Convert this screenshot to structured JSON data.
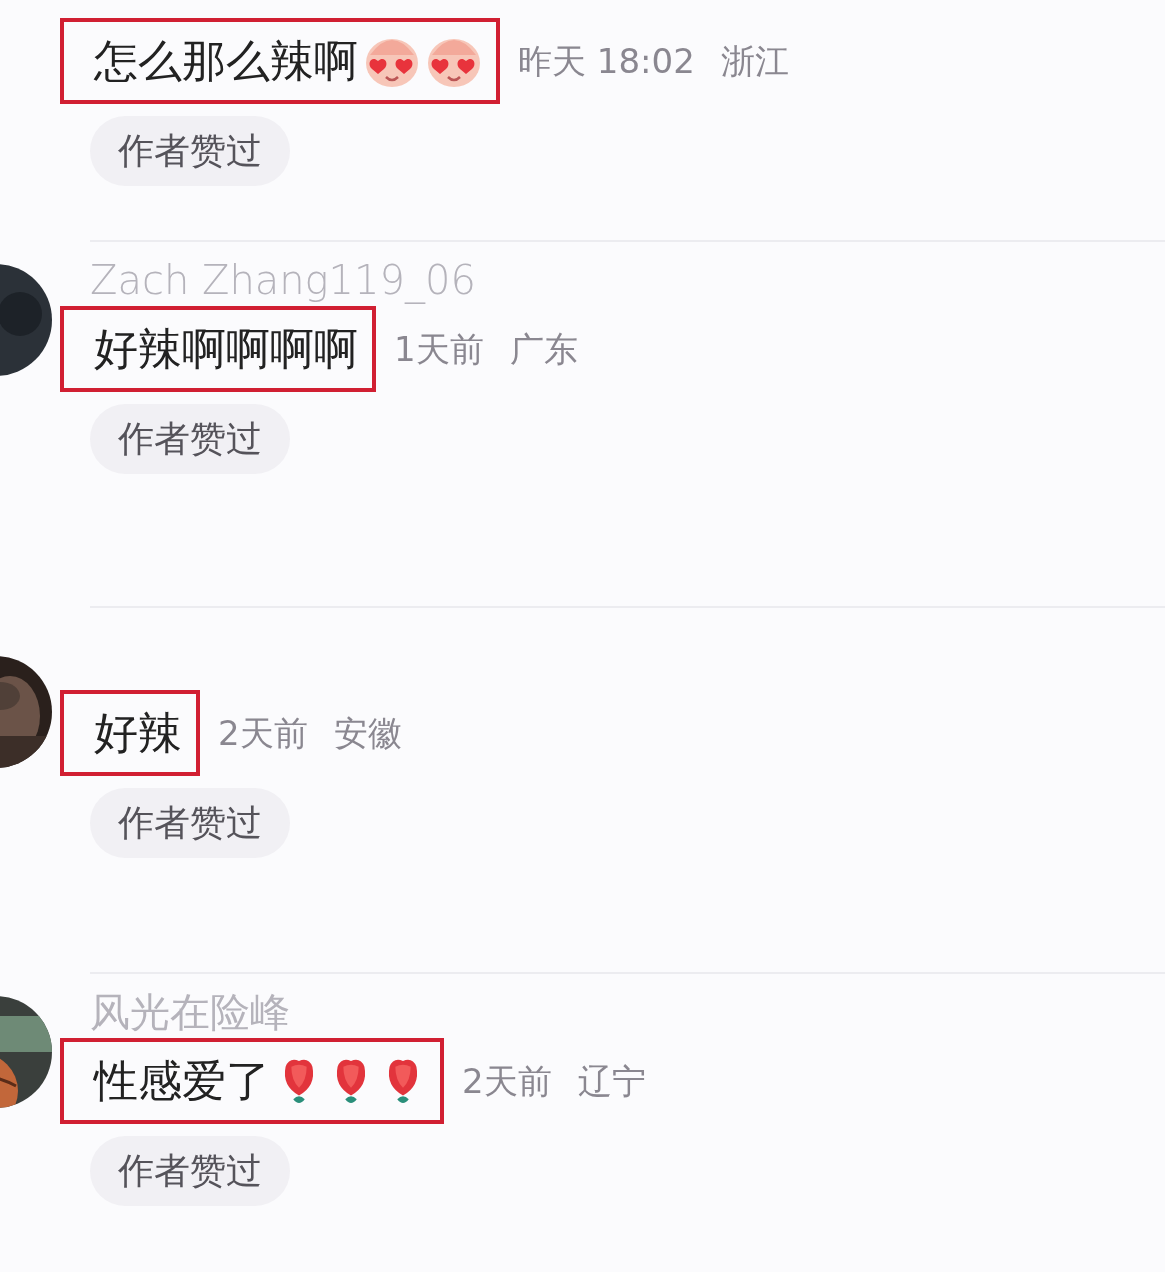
{
  "comments": [
    {
      "text": "怎么那么辣啊",
      "emojis": [
        {
          "kind": "blush-face"
        },
        {
          "kind": "blush-face"
        }
      ],
      "highlighted": true,
      "time": "昨天 18:02",
      "location": "浙江",
      "badge": "作者赞过"
    },
    {
      "avatar": {
        "kind": "picture"
      },
      "username": "Zach Zhang119_06",
      "text": "好辣啊啊啊啊",
      "highlighted": true,
      "time": "1天前",
      "location": "广东",
      "badge": "作者赞过"
    },
    {
      "avatar": {
        "kind": "picture"
      },
      "text": "好辣",
      "highlighted": true,
      "time": "2天前",
      "location": "安徽",
      "badge": "作者赞过"
    },
    {
      "avatar": {
        "kind": "picture"
      },
      "username": "风光在险峰",
      "text": "性感爱了",
      "emojis": [
        {
          "kind": "rose"
        },
        {
          "kind": "rose"
        },
        {
          "kind": "rose"
        }
      ],
      "highlighted": true,
      "time": "2天前",
      "location": "辽宁",
      "badge": "作者赞过"
    }
  ]
}
